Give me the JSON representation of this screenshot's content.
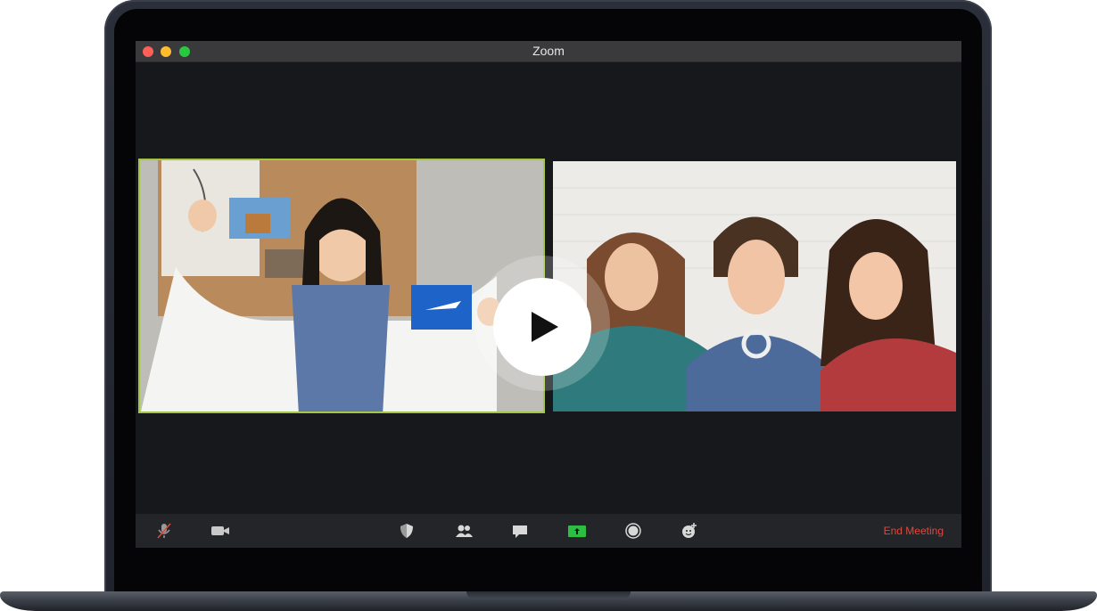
{
  "window": {
    "title": "Zoom"
  },
  "participants": [
    {
      "name": "",
      "active_speaker": true
    },
    {
      "name": "",
      "active_speaker": false
    }
  ],
  "toolbar": {
    "items": [
      {
        "icon": "mic-muted-icon"
      },
      {
        "icon": "video-camera-icon"
      },
      {
        "icon": "shield-icon"
      },
      {
        "icon": "participants-icon"
      },
      {
        "icon": "chat-icon"
      },
      {
        "icon": "share-screen-icon"
      },
      {
        "icon": "record-icon"
      },
      {
        "icon": "reactions-icon"
      }
    ],
    "end_meeting_label": "End Meeting"
  },
  "colors": {
    "active_speaker_border": "#a3c744",
    "share_green": "#2dbf41",
    "end_meeting": "#e0483e"
  }
}
